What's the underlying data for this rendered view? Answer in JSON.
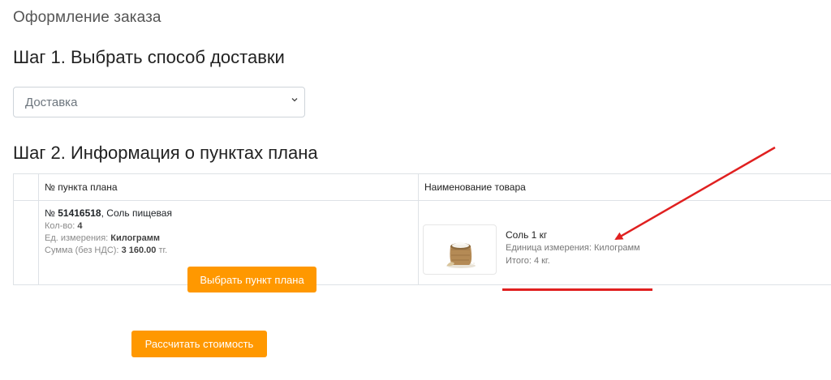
{
  "page": {
    "title": "Оформление заказа",
    "step1_title": "Шаг 1. Выбрать способ доставки",
    "step2_title": "Шаг 2. Информация о пунктах плана"
  },
  "delivery_select": {
    "value": "Доставка",
    "icon": "chevron-down-icon"
  },
  "table": {
    "headers": {
      "point_number": "№ пункта плана",
      "product_name": "Наименование товара"
    },
    "row": {
      "point_prefix": "№ ",
      "point_number": "51416518",
      "point_name": ", Соль пищевая",
      "qty_label": "Кол-во: ",
      "qty_value": "4",
      "unit_label": "Ед. измерения: ",
      "unit_value": "Килограмм",
      "sum_label": "Сумма (без НДС): ",
      "sum_value": "3 160.00",
      "sum_currency": " тг.",
      "select_button": "Выбрать пункт плана",
      "product": {
        "name": "Соль 1 кг",
        "unit_line": "Единица измерения: Килограмм",
        "total_line": "Итого: 4 кг.",
        "image_icon": "salt-sack-icon"
      }
    }
  },
  "actions": {
    "calculate_button": "Рассчитать стоимость"
  },
  "colors": {
    "accent": "#ff9800",
    "annotation": "#e02020"
  }
}
